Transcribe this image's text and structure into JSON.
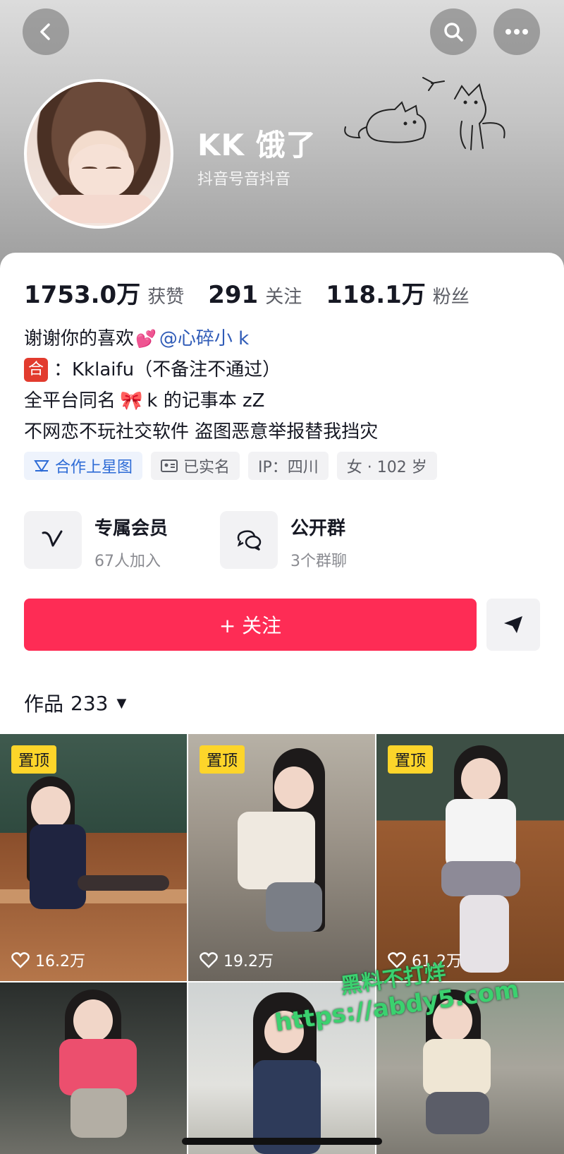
{
  "header": {
    "nickname": "KK 饿了",
    "douyin_id": "抖音号音抖音"
  },
  "stats": [
    {
      "value": "1753.0万",
      "label": "获赞"
    },
    {
      "value": "291",
      "label": "关注"
    },
    {
      "value": "118.1万",
      "label": "粉丝"
    }
  ],
  "bio": {
    "line1": "谢谢你的喜欢",
    "mention": "@心碎小 k",
    "badge": "合",
    "line2": "：Kklaifu（不备注不通过）",
    "line3a": "全平台同名",
    "line3b": "k 的记事本 zZ",
    "line4": "不网恋不玩社交软件 盗图恶意举报替我挡灾"
  },
  "tags": [
    "合作上星图",
    "已实名",
    "IP：四川",
    "女 · 102 岁"
  ],
  "features": {
    "vip_title": "专属会员",
    "vip_sub": "67人加入",
    "group_title": "公开群",
    "group_sub": "3个群聊"
  },
  "follow_label": "+ 关注",
  "works": {
    "label": "作品",
    "count": "233"
  },
  "videos": [
    {
      "pinned": "置顶",
      "likes": "16.2万"
    },
    {
      "pinned": "置顶",
      "likes": "19.2万"
    },
    {
      "pinned": "置顶",
      "likes": "61.2万"
    }
  ],
  "watermark": {
    "line1": "黑料不打烊",
    "line2": "https://abdy5.com"
  },
  "colors": {
    "accent": "#fe2c55",
    "pin": "#fdd52a",
    "mention": "#2f5bb7"
  }
}
